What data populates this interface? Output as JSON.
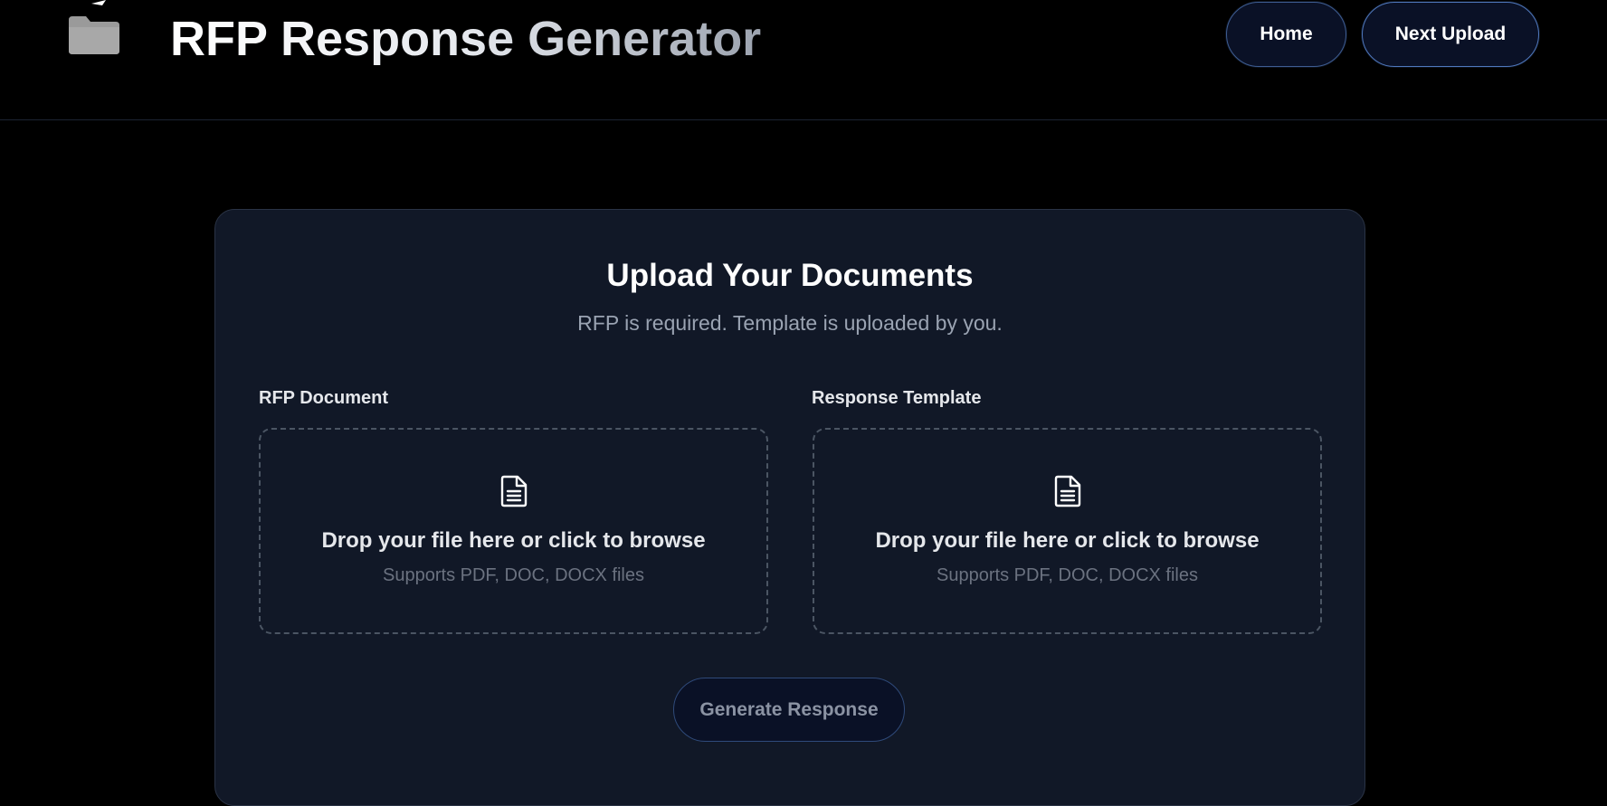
{
  "header": {
    "title": "RFP Response Generator",
    "logo_icon": "folder-icon",
    "nav": {
      "home_label": "Home",
      "next_upload_label": "Next Upload"
    }
  },
  "upload": {
    "title": "Upload Your Documents",
    "subtitle": "RFP is required. Template is uploaded by you.",
    "rfp": {
      "label": "RFP Document",
      "icon": "document-icon",
      "prompt": "Drop your file here or click to browse",
      "hint": "Supports PDF, DOC, DOCX files"
    },
    "template": {
      "label": "Response Template",
      "icon": "document-icon",
      "prompt": "Drop your file here or click to browse",
      "hint": "Supports PDF, DOC, DOCX files"
    },
    "generate_label": "Generate Response"
  },
  "colors": {
    "background": "#000000",
    "card": "#111827",
    "button_bg": "#0a1126",
    "button_border": "#4f78bd",
    "muted_text": "#6b7280"
  }
}
